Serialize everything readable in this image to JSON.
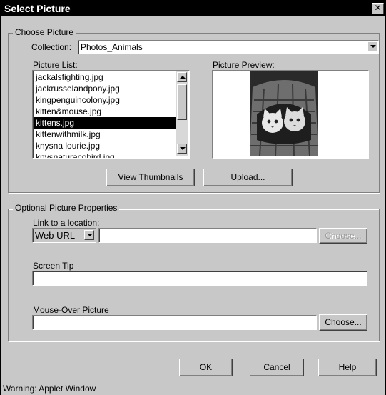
{
  "window": {
    "title": "Select Picture",
    "close_glyph": "✕"
  },
  "choose_picture": {
    "group_label": "Choose Picture",
    "collection_label": "Collection:",
    "collection_value": "Photos_Animals",
    "picture_list_label": "Picture List:",
    "picture_preview_label": "Picture Preview:",
    "items": [
      {
        "label": "jackalsfighting.jpg",
        "selected": false
      },
      {
        "label": "jackrusselandpony.jpg",
        "selected": false
      },
      {
        "label": "kingpenguincolony.jpg",
        "selected": false
      },
      {
        "label": "kitten&mouse.jpg",
        "selected": false
      },
      {
        "label": "kittens.jpg",
        "selected": true
      },
      {
        "label": "kittenwithmilk.jpg",
        "selected": false
      },
      {
        "label": "knysna lourie.jpg",
        "selected": false
      },
      {
        "label": "knysnaturacobird.jpg",
        "selected": false
      }
    ],
    "view_thumbnails_button": "View Thumbnails",
    "upload_button": "Upload..."
  },
  "optional_properties": {
    "group_label": "Optional Picture Properties",
    "link_label": "Link to a location:",
    "link_type_value": "Web URL",
    "link_url_value": "",
    "link_choose_button": "Choose...",
    "screen_tip_label": "Screen Tip",
    "screen_tip_value": "",
    "mouse_over_label": "Mouse-Over Picture",
    "mouse_over_value": "",
    "mouse_over_choose_button": "Choose..."
  },
  "footer": {
    "ok_button": "OK",
    "cancel_button": "Cancel",
    "help_button": "Help"
  },
  "status": {
    "text": "Warning: Applet Window"
  },
  "colors": {
    "face": "#c8c8c8",
    "selection": "#000000",
    "titlebar": "#000000"
  }
}
